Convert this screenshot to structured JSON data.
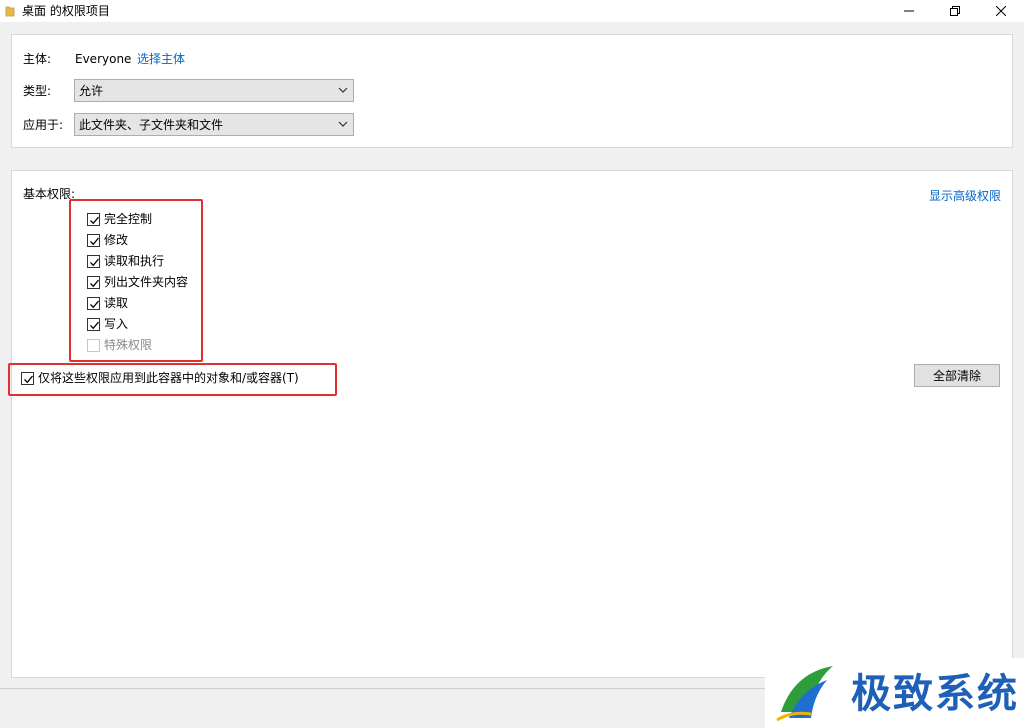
{
  "window": {
    "title": "桌面 的权限项目",
    "minimize_icon": "minimize-icon",
    "maximize_icon": "restore-icon",
    "close_icon": "close-icon"
  },
  "principal": {
    "label": "主体:",
    "value": "Everyone",
    "select_link": "选择主体"
  },
  "type": {
    "label": "类型:",
    "value": "允许"
  },
  "applies_to": {
    "label": "应用于:",
    "value": "此文件夹、子文件夹和文件"
  },
  "basic_permissions": {
    "label": "基本权限:",
    "advanced_link": "显示高级权限",
    "items": [
      {
        "label": "完全控制",
        "checked": true,
        "disabled": false
      },
      {
        "label": "修改",
        "checked": true,
        "disabled": false
      },
      {
        "label": "读取和执行",
        "checked": true,
        "disabled": false
      },
      {
        "label": "列出文件夹内容",
        "checked": true,
        "disabled": false
      },
      {
        "label": "读取",
        "checked": true,
        "disabled": false
      },
      {
        "label": "写入",
        "checked": true,
        "disabled": false
      },
      {
        "label": "特殊权限",
        "checked": false,
        "disabled": true
      }
    ]
  },
  "apply_only": {
    "label": "仅将这些权限应用到此容器中的对象和/或容器(T)",
    "checked": true
  },
  "clear_all_button": "全部清除",
  "watermark": {
    "text": "极致系统"
  },
  "colors": {
    "link": "#0066cc",
    "highlight": "#e03030",
    "watermark_text": "#1e5fb7"
  }
}
